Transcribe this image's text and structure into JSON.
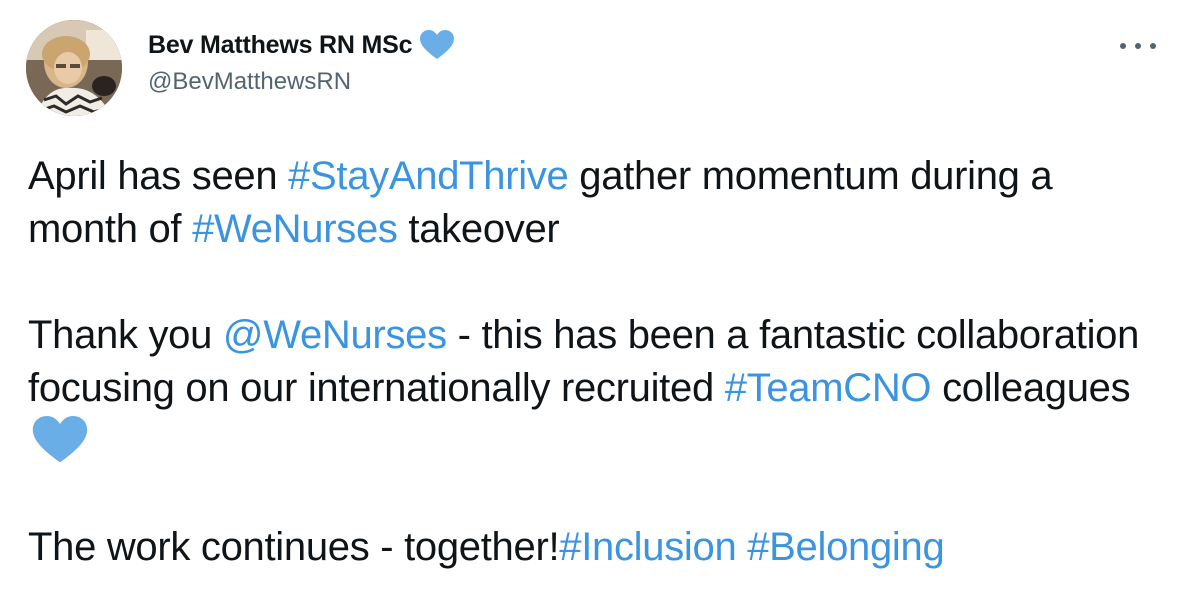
{
  "author": {
    "display_name": "Bev Matthews RN MSc",
    "handle": "@BevMatthewsRN",
    "badge_icon": "blue-heart-icon"
  },
  "more_icon": "more-horizontal-icon",
  "tweet": {
    "p1": {
      "t1": "April has seen ",
      "l1": "#StayAndThrive",
      "t2": " gather momentum during a month of ",
      "l2": "#WeNurses",
      "t3": " takeover"
    },
    "p2": {
      "t1": "Thank you ",
      "l1": "@WeNurses",
      "t2": " - this has been a fantastic collaboration focusing on our internationally recruited ",
      "l2": "#TeamCNO",
      "t3": " colleagues ",
      "emoji": "blue-heart-icon"
    },
    "p3": {
      "t1": "The work continues - together!",
      "l1": "#Inclusion",
      "t2": " ",
      "l2": "#Belonging"
    }
  },
  "colors": {
    "link": "#3b94e0",
    "heart": "#6aaee8",
    "text": "#0f1419",
    "secondary": "#536471"
  }
}
